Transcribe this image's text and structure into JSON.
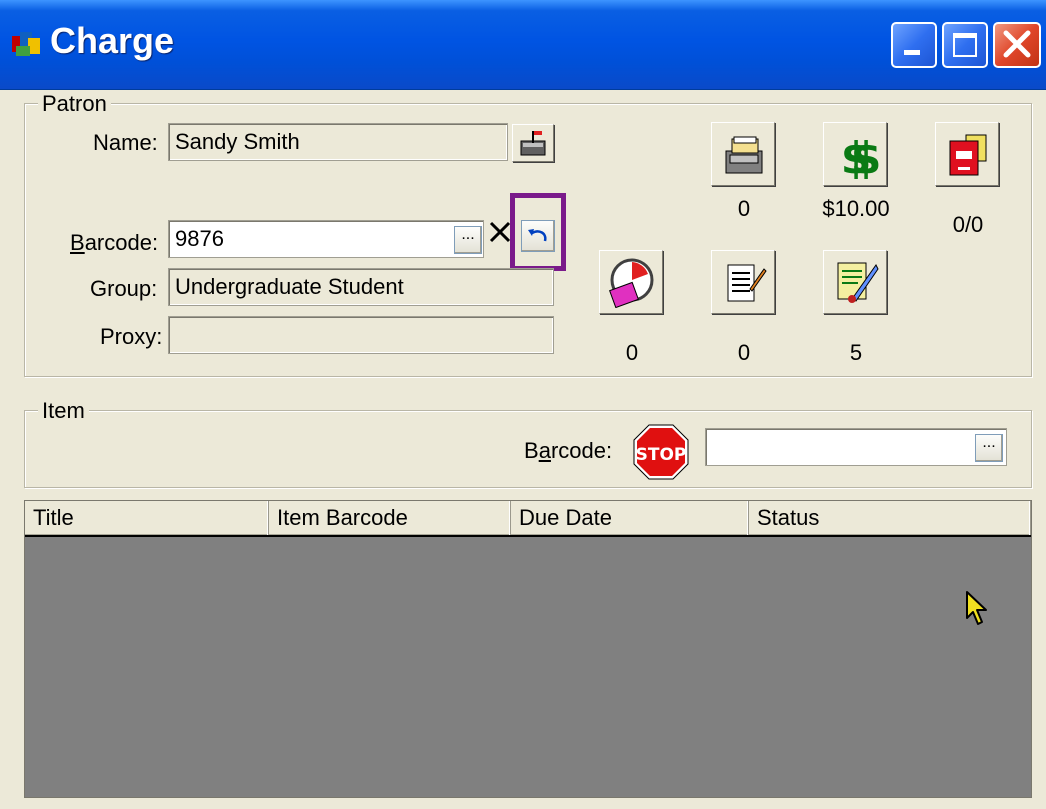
{
  "window": {
    "title": "Charge",
    "app_icon": "library-app-icon"
  },
  "window_controls": {
    "minimize": "minimize-icon",
    "maximize": "maximize-icon",
    "close": "close-icon"
  },
  "patron": {
    "legend": "Patron",
    "name_label": "Name:",
    "name_value": "Sandy Smith",
    "barcode_label": "Barcode:",
    "barcode_value": "9876",
    "browse_glyph": "...",
    "clear_glyph": "✕",
    "group_label": "Group:",
    "group_value": "Undergraduate Student",
    "proxy_label": "Proxy:",
    "proxy_value": "",
    "stats": {
      "holds": "0",
      "fines": "$10.00",
      "charges": "0/0",
      "overdue": "0",
      "notes": "0",
      "blocks": "5"
    }
  },
  "item": {
    "legend": "Item",
    "barcode_label": "Barcode:",
    "barcode_value": "",
    "stop_text": "STOP",
    "browse_glyph": "..."
  },
  "table": {
    "columns": [
      "Title",
      "Item Barcode",
      "Due Date",
      "Status"
    ],
    "rows": []
  },
  "colors": {
    "title_bar": "#0054e3",
    "highlight": "#7a1a8a",
    "table_bg": "#808080"
  }
}
